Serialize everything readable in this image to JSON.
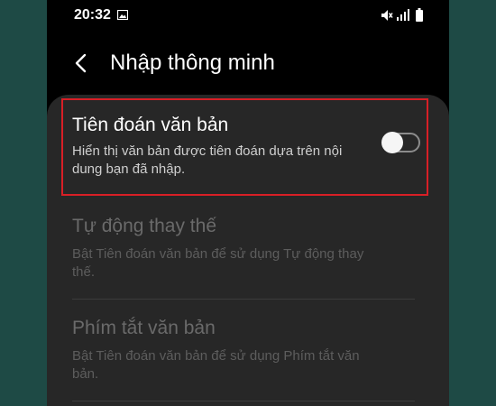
{
  "status_bar": {
    "time": "20:32",
    "icons": [
      "gallery-icon",
      "mute-icon",
      "signal-icon",
      "battery-icon"
    ]
  },
  "header": {
    "back_icon": "chevron-left-icon",
    "title": "Nhập thông minh"
  },
  "settings": [
    {
      "title": "Tiên đoán văn bản",
      "description": "Hiển thị văn bản được tiên đoán dựa trên nội dung bạn đã nhập.",
      "enabled": true,
      "toggle_on": false,
      "highlighted": true
    },
    {
      "title": "Tự động thay thế",
      "description": "Bật Tiên đoán văn bản để sử dụng Tự động thay thế.",
      "enabled": false
    },
    {
      "title": "Phím tắt văn bản",
      "description": "Bật Tiên đoán văn bản để sử dụng Phím tắt văn bản.",
      "enabled": false
    }
  ],
  "colors": {
    "background": "#1e4a45",
    "screen": "#000000",
    "card": "#272727",
    "highlight": "#d81f26",
    "disabled_text": "#6a6a6a"
  }
}
